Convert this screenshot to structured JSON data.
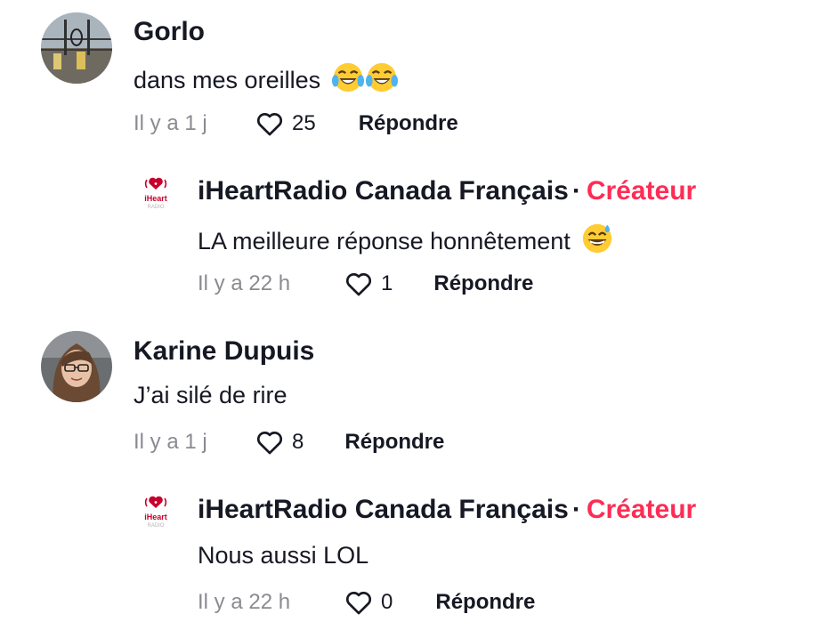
{
  "comments": [
    {
      "author": "Gorlo",
      "text": "dans mes oreilles",
      "emojis": [
        "face-with-tears-of-joy",
        "face-with-tears-of-joy"
      ],
      "time": "Il y a 1 j",
      "likes": "25",
      "reply_label": "Répondre",
      "reply": {
        "author": "iHeartRadio Canada Français",
        "separator": "·",
        "badge": "Créateur",
        "text": "LA meilleure réponse honnêtement",
        "emojis": [
          "grinning-face-with-sweat"
        ],
        "time": "Il y a 22 h",
        "likes": "1",
        "reply_label": "Répondre"
      }
    },
    {
      "author": "Karine Dupuis",
      "text": "J’ai silé de rire",
      "time": "Il y a 1 j",
      "likes": "8",
      "reply_label": "Répondre",
      "reply": {
        "author": "iHeartRadio Canada Français",
        "separator": "·",
        "badge": "Créateur",
        "text": "Nous aussi LOL",
        "time": "Il y a 22 h",
        "likes": "0",
        "reply_label": "Répondre"
      }
    }
  ],
  "logo": {
    "brand_text": "iHeart",
    "sub_text": "RADIO"
  },
  "colors": {
    "creator_badge": "#fe2c55",
    "meta_text": "#8a8b91",
    "primary_text": "#161823",
    "logo_red": "#c6002b"
  }
}
